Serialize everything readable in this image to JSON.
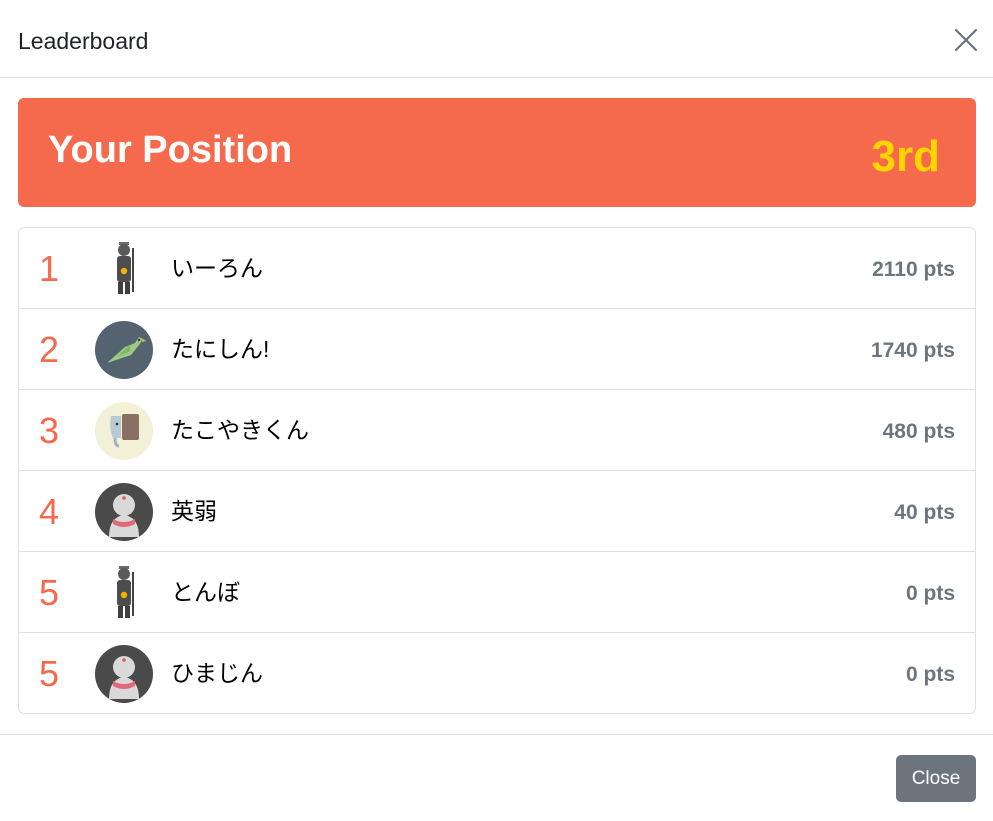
{
  "modal": {
    "title": "Leaderboard",
    "close_label": "Close"
  },
  "banner": {
    "title": "Your Position",
    "rank": "3rd",
    "background_color": "#f5694d",
    "rank_color": "#ffd400"
  },
  "leaderboard": [
    {
      "rank": "1",
      "name": "いーろん",
      "points": "2110 pts",
      "avatar": "monk-icon"
    },
    {
      "rank": "2",
      "name": "たにしん!",
      "points": "1740 pts",
      "avatar": "parrot-icon"
    },
    {
      "rank": "3",
      "name": "たこやきくん",
      "points": "480 pts",
      "avatar": "elephant-icon"
    },
    {
      "rank": "4",
      "name": "英弱",
      "points": "40 pts",
      "avatar": "jizo-icon"
    },
    {
      "rank": "5",
      "name": "とんぼ",
      "points": "0 pts",
      "avatar": "monk-icon"
    },
    {
      "rank": "5",
      "name": "ひまじん",
      "points": "0 pts",
      "avatar": "jizo-icon"
    }
  ]
}
